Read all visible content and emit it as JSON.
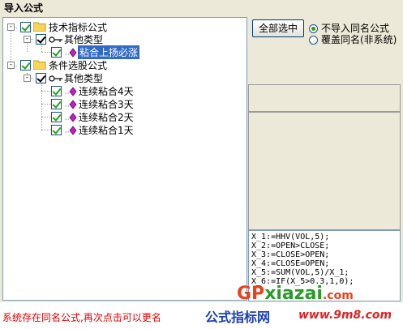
{
  "window": {
    "title": "导入公式"
  },
  "tree": {
    "groups": [
      {
        "label": "技术指标公式",
        "expand": "-",
        "sub": {
          "label": "其他类型",
          "expand": "-",
          "items": [
            {
              "label": "粘合上扬必涨",
              "selected": true
            }
          ]
        }
      },
      {
        "label": "条件选股公式",
        "expand": "-",
        "sub": {
          "label": "其他类型",
          "expand": "-",
          "items": [
            {
              "label": "连续粘合4天"
            },
            {
              "label": "连续粘合3天"
            },
            {
              "label": "连续粘合2天"
            },
            {
              "label": "连续粘合1天"
            }
          ]
        }
      }
    ]
  },
  "buttons": {
    "select_all": "全部选中"
  },
  "options": {
    "no_import": "不导入同名公式",
    "overwrite": "覆盖同名(非系统)",
    "selected": "no_import"
  },
  "code_lines": [
    "X_1:=HHV(VOL,5);",
    "X_2:=OPEN>CLOSE;",
    "X_3:=CLOSE>OPEN;",
    "X_4:=CLOSE=OPEN;",
    "X_5:=SUM(VOL,5)/X_1;",
    "X_6:=IF(X_5>0.3,1,0);"
  ],
  "status": "系统存在同名公式,再次点击可以更名",
  "watermarks": {
    "gp": "GP",
    "xiazai": "xiazai",
    "com": ".com",
    "site_name": "公式指标网",
    "site_url": "www.9m8.com"
  },
  "colors": {
    "selection": "#316ac5",
    "status": "#e00000",
    "check": "#21a121"
  }
}
